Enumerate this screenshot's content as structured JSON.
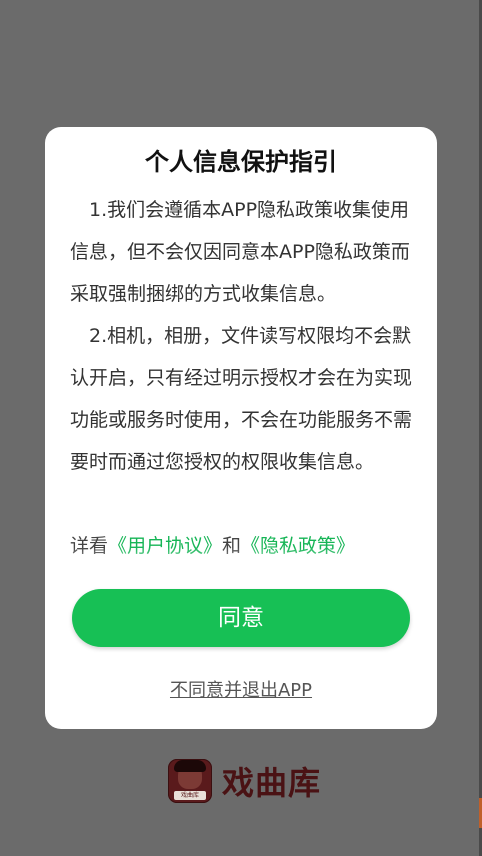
{
  "background": {
    "brand_name": "戏曲库",
    "logo_tag": "戏曲库"
  },
  "dialog": {
    "title": "个人信息保护指引",
    "paragraph_1": "1.我们会遵循本APP隐私政策收集使用信息，但不会仅因同意本APP隐私政策而采取强制捆绑的方式收集信息。",
    "paragraph_2": "2.相机，相册，文件读写权限均不会默认开启，只有经过明示授权才会在为实现功能或服务时使用，不会在功能服务不需要时而通过您授权的权限收集信息。",
    "links_prefix": "详看",
    "user_agreement_link": "《用户协议》",
    "links_and": "和",
    "privacy_policy_link": "《隐私政策》",
    "agree_label": "同意",
    "exit_label": "不同意并退出APP"
  },
  "colors": {
    "accent": "#17c055",
    "link": "#16b556",
    "scrim": "#6b6b6b",
    "brand": "#4a1214"
  }
}
